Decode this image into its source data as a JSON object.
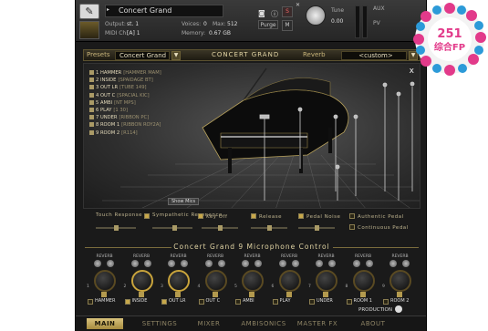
{
  "header": {
    "instrument_name": "Concert Grand",
    "output_label": "Output:",
    "output_value": "st. 1",
    "midi_label": "MIDI Ch:",
    "midi_value": "[A] 1",
    "voices_label": "Voices:",
    "voices_value": "0",
    "max_label": "Max:",
    "max_value": "512",
    "memory_label": "Memory:",
    "memory_value": "0.67 GB",
    "purge_label": "Purge",
    "solo_label": "S",
    "mute_label": "M",
    "tune_label": "Tune",
    "tune_value": "0.00",
    "aux_label": "AUX",
    "pv_label": "PV"
  },
  "topbar": {
    "presets_label": "Presets",
    "preset_value": "Concert Grand",
    "title": "CONCERT GRAND",
    "reverb_label": "Reverb",
    "reverb_value": "<custom>"
  },
  "view": {
    "close_label": "x",
    "show_mics_label": "Show Mics",
    "mics": [
      {
        "label": "1 HAMMER",
        "sub": "[HAMMER MAM]"
      },
      {
        "label": "2 INSIDE",
        "sub": "[SPAIDAGE BT]"
      },
      {
        "label": "3 OUT LR",
        "sub": "[TUBE 149]"
      },
      {
        "label": "4 OUT C",
        "sub": "[SPACIAL KIC]"
      },
      {
        "label": "5 AMBI",
        "sub": "[NT MPS]"
      },
      {
        "label": "6 PLAY",
        "sub": "[1 30]"
      },
      {
        "label": "7 UNDER",
        "sub": "[RIBBON PC]"
      },
      {
        "label": "8 ROOM 1",
        "sub": "[RIBBON ROY2A]"
      },
      {
        "label": "9 ROOM 2",
        "sub": "[R114]"
      }
    ]
  },
  "options": {
    "touch_response": "Touch Response",
    "sympathetic_resonance": "Sympathetic Resonance",
    "key_off": "Key Off",
    "release": "Release",
    "pedal_noise": "Pedal Noise",
    "authentic_pedal": "Authentic Pedal",
    "continuous_pedal": "Continuous Pedal"
  },
  "mic_control": {
    "title": "Concert Grand 9 Microphone Control",
    "reverb_label": "REVERB",
    "channels": [
      {
        "num": "1",
        "name": "HAMMER",
        "on": false
      },
      {
        "num": "2",
        "name": "INSIDE",
        "on": true
      },
      {
        "num": "3",
        "name": "OUT LR",
        "on": true
      },
      {
        "num": "4",
        "name": "OUT C",
        "on": false
      },
      {
        "num": "5",
        "name": "AMBI",
        "on": false
      },
      {
        "num": "6",
        "name": "PLAY",
        "on": false
      },
      {
        "num": "7",
        "name": "UNDER",
        "on": false
      },
      {
        "num": "8",
        "name": "ROOM 1",
        "on": false
      },
      {
        "num": "9",
        "name": "ROOM 2",
        "on": false
      }
    ],
    "production_label": "PRODUCTION"
  },
  "tabs": [
    "MAIN",
    "SETTINGS",
    "MIXER",
    "AMBISONICS",
    "MASTER FX",
    "ABOUT"
  ],
  "badge": {
    "number": "251",
    "text": "综合FP"
  },
  "colors": {
    "accent": "#c9a43c",
    "background": "#1a1a1a",
    "badge_pink": "#e23a8a"
  }
}
